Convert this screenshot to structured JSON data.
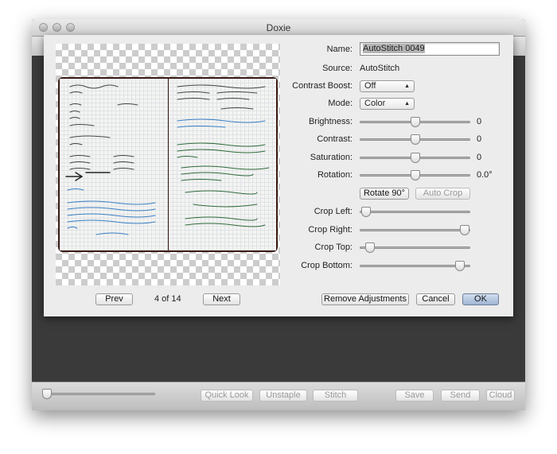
{
  "window": {
    "title": "Doxie"
  },
  "preview": {
    "page_indicator": "4 of 14",
    "prev_label": "Prev",
    "next_label": "Next"
  },
  "form": {
    "name_label": "Name:",
    "name_value": "AutoStitch 0049",
    "source_label": "Source:",
    "source_value": "AutoStitch",
    "contrast_boost_label": "Contrast Boost:",
    "contrast_boost_value": "Off",
    "mode_label": "Mode:",
    "mode_value": "Color",
    "sliders": [
      {
        "label": "Brightness:",
        "value": "0",
        "fraction": 0.5
      },
      {
        "label": "Contrast:",
        "value": "0",
        "fraction": 0.5
      },
      {
        "label": "Saturation:",
        "value": "0",
        "fraction": 0.5
      },
      {
        "label": "Rotation:",
        "value": "0.0°",
        "fraction": 0.5
      }
    ],
    "rotate_label": "Rotate 90°",
    "auto_crop_label": "Auto Crop",
    "crop_sliders": [
      {
        "label": "Crop Left:",
        "fraction": 0.06
      },
      {
        "label": "Crop Right:",
        "fraction": 0.95
      },
      {
        "label": "Crop Top:",
        "fraction": 0.09
      },
      {
        "label": "Crop Bottom:",
        "fraction": 0.91
      }
    ],
    "remove_adjustments_label": "Remove Adjustments",
    "cancel_label": "Cancel",
    "ok_label": "OK"
  },
  "bottombar": {
    "zoom_fraction": 0.03,
    "quick_look": "Quick Look",
    "unstaple": "Unstaple",
    "stitch": "Stitch",
    "save": "Save",
    "send": "Send",
    "cloud": "Cloud"
  }
}
